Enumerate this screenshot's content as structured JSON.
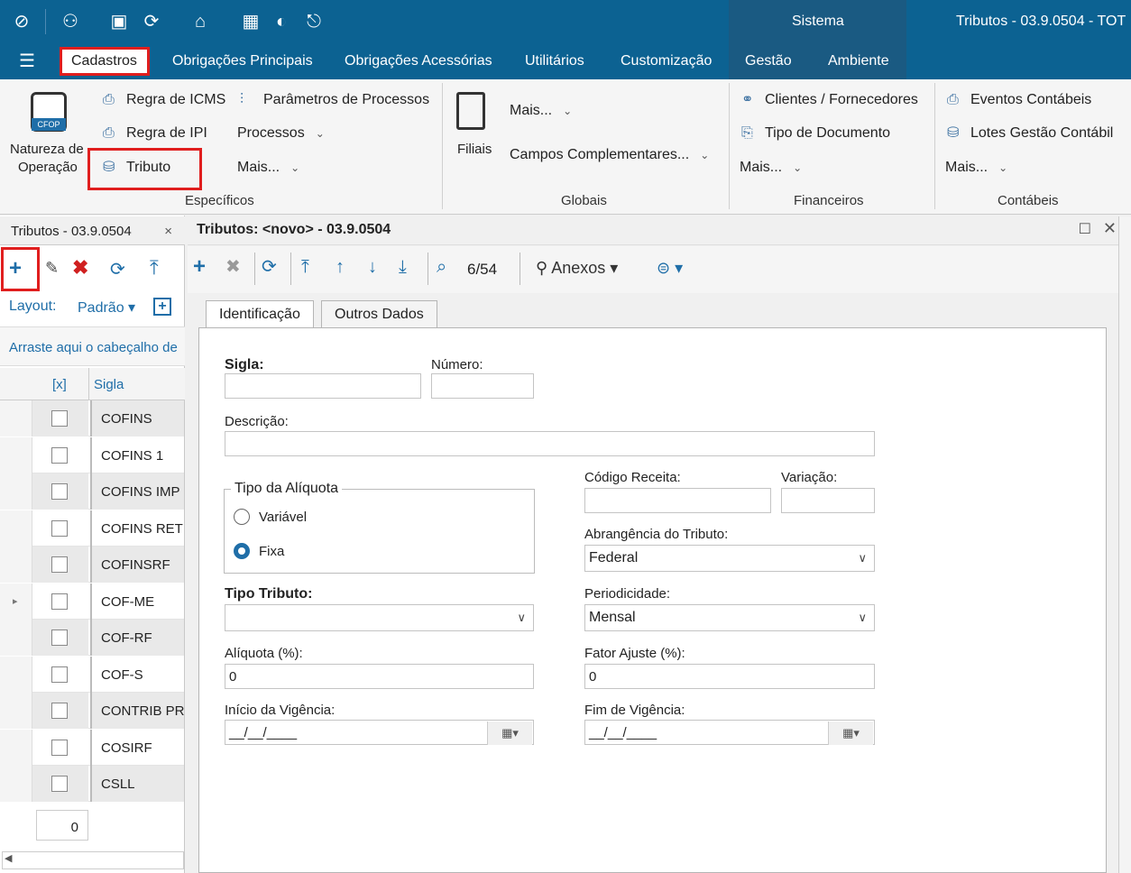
{
  "app": {
    "title": "Tributos - 03.9.0504 - TOT",
    "sistema_label": "Sistema"
  },
  "menu": {
    "items": [
      "Cadastros",
      "Obrigações Principais",
      "Obrigações Acessórias",
      "Utilitários",
      "Customização",
      "Gestão",
      "Ambiente"
    ]
  },
  "ribbon": {
    "natureza_line1": "Natureza de",
    "natureza_line2": "Operação",
    "cfop_badge": "CFOP",
    "regra_icms": "Regra de ICMS",
    "regra_ipi": "Regra de IPI",
    "tributo": "Tributo",
    "parametros": "Parâmetros de Processos",
    "processos": "Processos",
    "mais1": "Mais...",
    "especificos": "Específicos",
    "filiais": "Filiais",
    "mais2": "Mais...",
    "campos": "Campos Complementares...",
    "globais": "Globais",
    "clientes": "Clientes / Fornecedores",
    "tipo_doc": "Tipo de Documento",
    "mais3": "Mais...",
    "financeiros": "Financeiros",
    "eventos": "Eventos Contábeis",
    "lotes": "Lotes Gestão Contábil",
    "mais4": "Mais...",
    "contabeis": "Contábeis"
  },
  "left": {
    "tab_title": "Tributos - 03.9.0504",
    "layout_label": "Layout:",
    "layout_value": "Padrão",
    "group_hint": "Arraste aqui o cabeçalho de",
    "col_check": "[x]",
    "col_sigla": "Sigla",
    "rows": [
      "COFINS",
      "COFINS 1",
      "COFINS IMP",
      "COFINS RET",
      "COFINSRF",
      "COF-ME",
      "COF-RF",
      "COF-S",
      "CONTRIB PR",
      "COSIRF",
      "CSLL"
    ],
    "footer_count": "0"
  },
  "main": {
    "header_title": "Tributos: <novo> - 03.9.0504",
    "record_pos": "6/54",
    "anexos": "Anexos",
    "tabs": [
      "Identificação",
      "Outros Dados"
    ]
  },
  "form": {
    "sigla_label": "Sigla:",
    "numero_label": "Número:",
    "descricao_label": "Descrição:",
    "tipo_aliquota_label": "Tipo da Alíquota",
    "variavel": "Variável",
    "fixa": "Fixa",
    "codigo_receita_label": "Código Receita:",
    "variacao_label": "Variação:",
    "abrangencia_label": "Abrangência do Tributo:",
    "abrangencia_value": "Federal",
    "tipo_tributo_label": "Tipo Tributo:",
    "periodicidade_label": "Periodicidade:",
    "periodicidade_value": "Mensal",
    "aliquota_label": "Alíquota (%):",
    "aliquota_value": "0",
    "fator_label": "Fator Ajuste (%):",
    "fator_value": "0",
    "inicio_label": "Início da Vigência:",
    "inicio_value": "__/__/____",
    "fim_label": "Fim de Vigência:",
    "fim_value": "__/__/____"
  }
}
